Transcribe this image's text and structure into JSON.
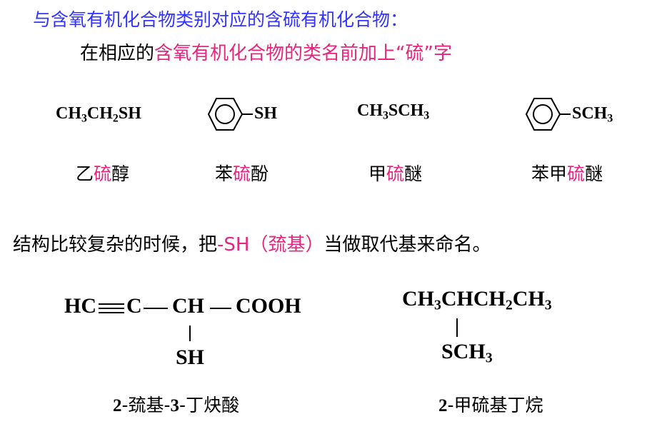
{
  "title": "与含氧有机化合物类别对应的含硫有机化合物：",
  "rule": {
    "prefix": "在相应的",
    "highlight": "含氧有机化合物的类名前加上“硫”字"
  },
  "examples": [
    {
      "formula_parts": [
        "CH",
        "3",
        "CH",
        "2",
        "SH"
      ],
      "name_pre": "乙",
      "name_hl": "硫",
      "name_post": "醇"
    },
    {
      "substituent": "SH",
      "name_pre": "苯",
      "name_hl": "硫",
      "name_post": "酚"
    },
    {
      "formula_parts": [
        "CH",
        "3",
        "SCH",
        "3"
      ],
      "name_pre": "甲",
      "name_hl": "硫",
      "name_post": "醚"
    },
    {
      "substituent_parts": [
        "SCH",
        "3"
      ],
      "name_pre": "苯甲",
      "name_hl": "硫",
      "name_post": "醚"
    }
  ],
  "complex_rule": {
    "prefix": "结构比较复杂的时候，把",
    "highlight": "-SH（巯基）",
    "suffix": "当做取代基来命名。"
  },
  "compound1": {
    "hc": "HC",
    "c": "C",
    "ch": "CH",
    "cooh": "COOH",
    "sh": "SH",
    "name_num1": "2",
    "name_mid": "-巯基-",
    "name_num2": "3",
    "name_end": "-丁炔酸"
  },
  "compound2": {
    "main_parts": [
      "CH",
      "3",
      "CHCH",
      "2",
      "CH",
      "3"
    ],
    "sub_parts": [
      "SCH",
      "3"
    ],
    "name_num": "2",
    "name_end": "-甲硫基丁烷"
  },
  "colors": {
    "title": "#3333ff",
    "highlight": "#e6267e",
    "text": "#000000"
  }
}
